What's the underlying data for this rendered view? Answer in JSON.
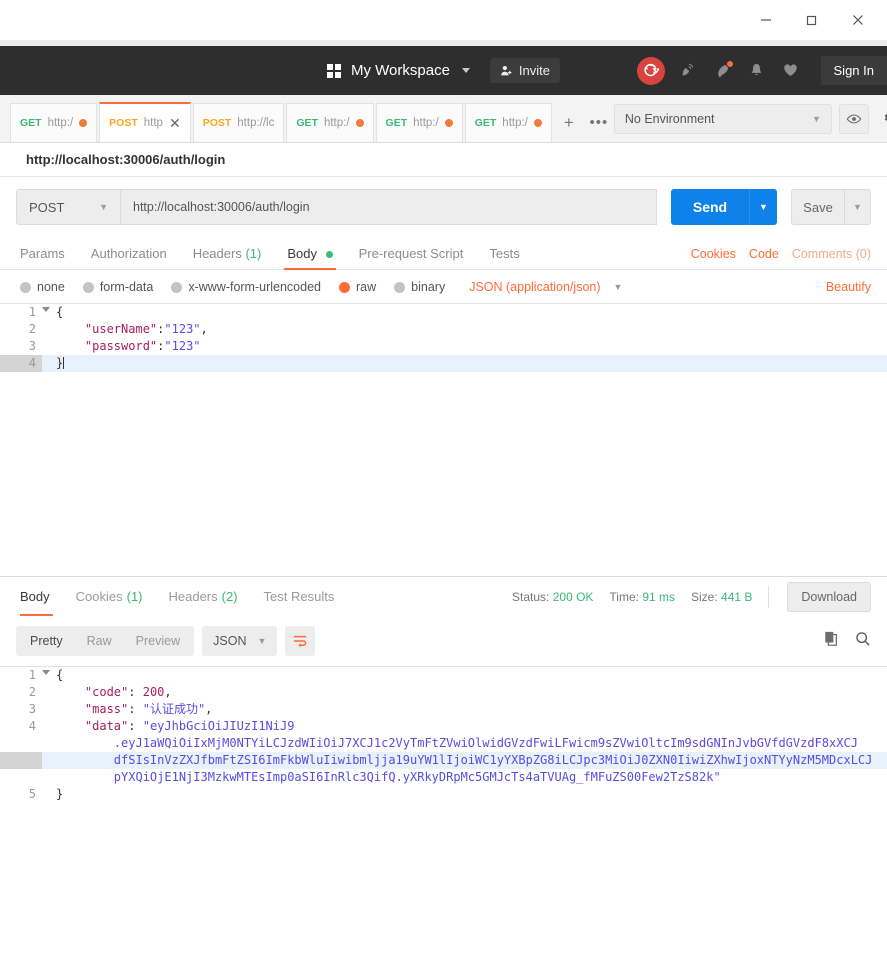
{
  "window": {
    "minimize_label": "minimize-window",
    "restore_label": "restore-window",
    "close_label": "close-window"
  },
  "header": {
    "workspace_name": "My Workspace",
    "invite_label": "Invite",
    "signin_label": "Sign In",
    "icons": [
      "sync-icon",
      "satellite-icon",
      "rocket-icon",
      "bell-icon",
      "heart-icon"
    ],
    "accent_color": "#ff6c37",
    "sync_color": "#d9443f",
    "bg_color": "#2e2e2e"
  },
  "tabs": {
    "items": [
      {
        "method": "GET",
        "url": "http:/",
        "dirty": true,
        "active": false
      },
      {
        "method": "POST",
        "url": "http",
        "dirty": false,
        "active": true
      },
      {
        "method": "POST",
        "url": "http://lc",
        "dirty": false,
        "active": false
      },
      {
        "method": "GET",
        "url": "http:/",
        "dirty": true,
        "active": false
      },
      {
        "method": "GET",
        "url": "http:/",
        "dirty": true,
        "active": false
      },
      {
        "method": "GET",
        "url": "http:/",
        "dirty": true,
        "active": false
      }
    ],
    "new_tab_label": "+",
    "more_label": "•••"
  },
  "environment": {
    "selected": "No Environment",
    "eye_icon": "eye-icon",
    "gear_icon": "gear-icon"
  },
  "request": {
    "title": "http://localhost:30006/auth/login",
    "method": "POST",
    "url": "http://localhost:30006/auth/login",
    "send_label": "Send",
    "save_label": "Save",
    "tabs": [
      {
        "label": "Params",
        "active": false,
        "badge": ""
      },
      {
        "label": "Authorization",
        "active": false,
        "badge": ""
      },
      {
        "label": "Headers",
        "active": false,
        "badge": "(1)"
      },
      {
        "label": "Body",
        "active": true,
        "badge": ""
      },
      {
        "label": "Pre-request Script",
        "active": false,
        "badge": ""
      },
      {
        "label": "Tests",
        "active": false,
        "badge": ""
      }
    ],
    "right_links": [
      {
        "label": "Cookies",
        "muted": false
      },
      {
        "label": "Code",
        "muted": false
      },
      {
        "label": "Comments (0)",
        "muted": true
      }
    ],
    "body_types": [
      {
        "label": "none",
        "selected": false
      },
      {
        "label": "form-data",
        "selected": false
      },
      {
        "label": "x-www-form-urlencoded",
        "selected": false
      },
      {
        "label": "raw",
        "selected": true
      },
      {
        "label": "binary",
        "selected": false
      }
    ],
    "content_type": "JSON (application/json)",
    "beautify_label": "Beautify",
    "body_lines": [
      {
        "num": "1",
        "fold": true,
        "highlight": false,
        "segments": [
          {
            "t": "{",
            "c": ""
          }
        ]
      },
      {
        "num": "2",
        "fold": false,
        "highlight": false,
        "segments": [
          {
            "t": "    ",
            "c": ""
          },
          {
            "t": "\"userName\"",
            "c": "k"
          },
          {
            "t": ":",
            "c": ""
          },
          {
            "t": "\"123\"",
            "c": "s"
          },
          {
            "t": ",",
            "c": ""
          }
        ]
      },
      {
        "num": "3",
        "fold": false,
        "highlight": false,
        "segments": [
          {
            "t": "    ",
            "c": ""
          },
          {
            "t": "\"password\"",
            "c": "k"
          },
          {
            "t": ":",
            "c": ""
          },
          {
            "t": "\"123\"",
            "c": "s"
          }
        ]
      },
      {
        "num": "4",
        "fold": false,
        "highlight": true,
        "segments": [
          {
            "t": "}",
            "c": ""
          }
        ]
      }
    ]
  },
  "response": {
    "tabs": [
      {
        "label": "Body",
        "active": true,
        "badge": ""
      },
      {
        "label": "Cookies",
        "active": false,
        "badge": "(1)"
      },
      {
        "label": "Headers",
        "active": false,
        "badge": "(2)"
      },
      {
        "label": "Test Results",
        "active": false,
        "badge": ""
      }
    ],
    "status_label": "Status:",
    "status_value": "200 OK",
    "time_label": "Time:",
    "time_value": "91 ms",
    "size_label": "Size:",
    "size_value": "441 B",
    "download_label": "Download",
    "view_modes": [
      {
        "label": "Pretty",
        "active": true
      },
      {
        "label": "Raw",
        "active": false
      },
      {
        "label": "Preview",
        "active": false
      }
    ],
    "format": "JSON",
    "wrap_icon": "word-wrap-icon",
    "copy_icon": "copy-icon",
    "search_icon": "search-icon",
    "body_lines": [
      {
        "num": "1",
        "fold": true,
        "highlight": false,
        "segments": [
          {
            "t": "{",
            "c": ""
          }
        ]
      },
      {
        "num": "2",
        "fold": false,
        "highlight": false,
        "segments": [
          {
            "t": "    ",
            "c": ""
          },
          {
            "t": "\"code\"",
            "c": "k"
          },
          {
            "t": ": ",
            "c": ""
          },
          {
            "t": "200",
            "c": "n"
          },
          {
            "t": ",",
            "c": ""
          }
        ]
      },
      {
        "num": "3",
        "fold": false,
        "highlight": false,
        "segments": [
          {
            "t": "    ",
            "c": ""
          },
          {
            "t": "\"mass\"",
            "c": "k"
          },
          {
            "t": ": ",
            "c": ""
          },
          {
            "t": "\"认证成功\"",
            "c": "s"
          },
          {
            "t": ",",
            "c": ""
          }
        ]
      },
      {
        "num": "4",
        "fold": false,
        "highlight": false,
        "segments": [
          {
            "t": "    ",
            "c": ""
          },
          {
            "t": "\"data\"",
            "c": "k"
          },
          {
            "t": ": ",
            "c": ""
          },
          {
            "t": "\"eyJhbGciOiJIUzI1NiJ9",
            "c": "s"
          }
        ]
      },
      {
        "num": "",
        "fold": false,
        "highlight": false,
        "segments": [
          {
            "t": "        .eyJ1aWQiOiIxMjM0NTYiLCJzdWIiOiJ7XCJ1c2VyTmFtZVwiOlwidGVzdFwiLFwicm9sZVwiOltcIm9sdGNInJvbGVfdGVzdF8xXCJ",
            "c": "s"
          }
        ]
      },
      {
        "num": "",
        "fold": false,
        "highlight": true,
        "segments": [
          {
            "t": "        dfSIsInVzZXJfbmFtZSI6ImFkbWluIiwibmljja19uYW1lIjoiWC1yYXBpZG8iLCJpc3MiOiJ0ZXN0IiwiZXhwIjoxNTYyNzM5MDcxLCJ",
            "c": "s"
          }
        ]
      },
      {
        "num": "",
        "fold": false,
        "highlight": false,
        "segments": [
          {
            "t": "        pYXQiOjE1NjI3MzkwMTEsImp0aSI6InRlc3QifQ.yXRkyDRpMc5GMJcTs4aTVUAg_fMFuZS00Few2TzS82k\"",
            "c": "s"
          }
        ]
      },
      {
        "num": "5",
        "fold": false,
        "highlight": false,
        "segments": [
          {
            "t": "}",
            "c": ""
          }
        ]
      }
    ]
  }
}
